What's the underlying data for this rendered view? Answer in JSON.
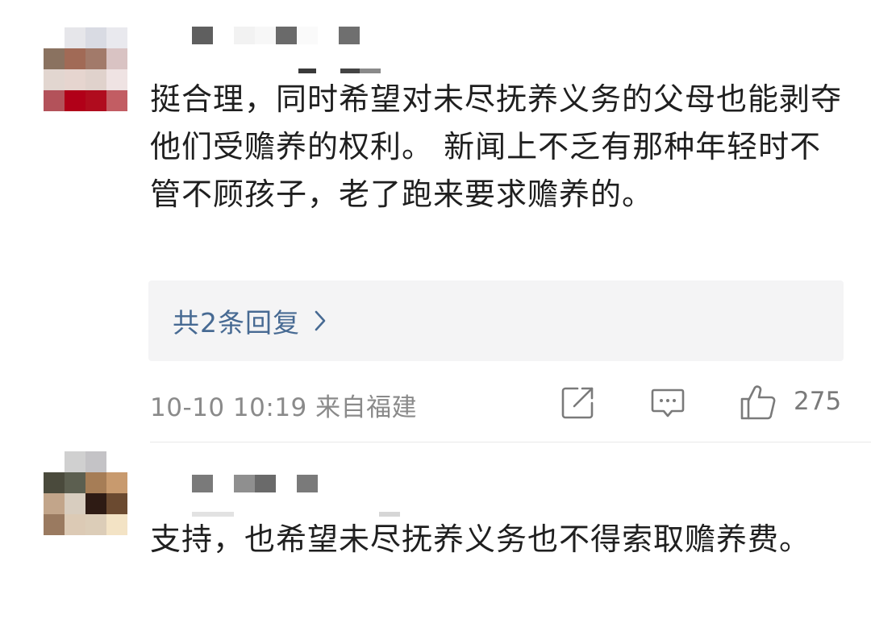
{
  "comments": [
    {
      "text": "挺合理，同时希望对未尽抚养义务的父母也能剥夺他们受赡养的权利。 新闻上不乏有那种年轻时不管不顾孩子，老了跑来要求赡养的。",
      "reply_link": "共2条回复",
      "timestamp_location": "10-10 10:19 来自福建",
      "like_count": "275"
    },
    {
      "text": "支持，也希望未尽抚养义务也不得索取赡养费。"
    }
  ],
  "colors": {
    "reply_link": "#476a93",
    "meta_text": "#8a8a8a",
    "reply_box_bg": "#f4f4f5",
    "icon_stroke": "#7a7a7a"
  },
  "icons": {
    "reply_chevron": "chevron-right-icon",
    "share": "share-edit-icon",
    "comment": "comment-bubble-icon",
    "like": "thumbs-up-icon"
  }
}
